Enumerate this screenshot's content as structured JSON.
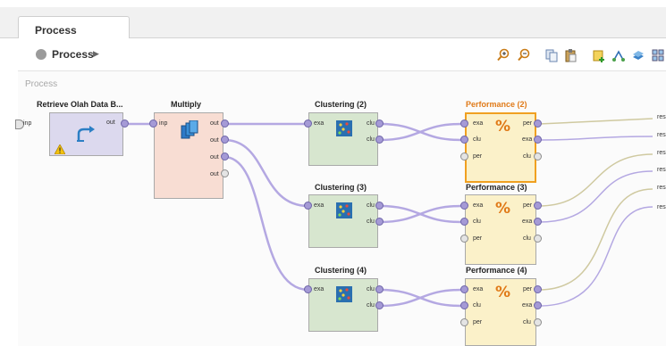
{
  "tab": {
    "label": "Process"
  },
  "breadcrumb": {
    "label": "Process"
  },
  "canvas": {
    "label": "Process"
  },
  "operators": {
    "retrieve": {
      "title": "Retrieve Olah Data B...",
      "out": "out",
      "inp": "inp"
    },
    "multiply": {
      "title": "Multiply",
      "inp": "inp",
      "out": "out"
    },
    "clustering2": {
      "title": "Clustering (2)"
    },
    "clustering3": {
      "title": "Clustering (3)"
    },
    "clustering4": {
      "title": "Clustering (4)"
    },
    "performance2": {
      "title": "Performance (2)"
    },
    "performance3": {
      "title": "Performance (3)"
    },
    "performance4": {
      "title": "Performance (4)"
    }
  },
  "ports": {
    "exa": "exa",
    "clu": "clu",
    "per": "per"
  },
  "result_label": "res",
  "colors": {
    "accent_orange": "#e07a18",
    "port_purple": "#a59ad6",
    "wire_purple": "#b4a8e2",
    "wire_olive": "#cfc9a0"
  }
}
